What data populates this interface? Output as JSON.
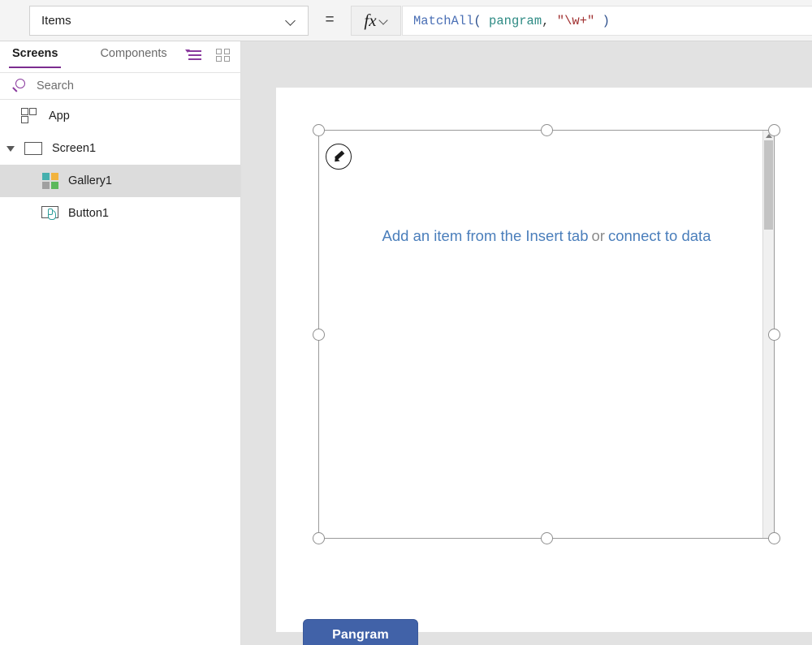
{
  "formula_bar": {
    "property_label": "Items",
    "property_icon": "chevron-down-icon",
    "equals": "=",
    "fx_label": "fx",
    "fx_icon": "fx-chevron-down-icon",
    "formula_tokens": [
      {
        "text": "MatchAll",
        "kind": "fn"
      },
      {
        "text": "(",
        "kind": "paren"
      },
      {
        "text": " ",
        "kind": "space"
      },
      {
        "text": "pangram",
        "kind": "ident"
      },
      {
        "text": ",",
        "kind": "punct"
      },
      {
        "text": " ",
        "kind": "space"
      },
      {
        "text": "\"\\w+\"",
        "kind": "string"
      },
      {
        "text": " ",
        "kind": "space"
      },
      {
        "text": ")",
        "kind": "paren"
      }
    ],
    "formula_plain": "MatchAll( pangram, \"\\w+\" )"
  },
  "left_panel": {
    "tabs": [
      {
        "label": "Screens",
        "active": true
      },
      {
        "label": "Components",
        "active": false
      }
    ],
    "tool_icons": [
      {
        "name": "tree-view-icon",
        "color": "#8a3a9e"
      },
      {
        "name": "thumbnail-grid-icon",
        "color": "#9a9a9a"
      }
    ],
    "search": {
      "placeholder": "Search",
      "value": "",
      "icon": "search-icon"
    },
    "tree": [
      {
        "label": "App",
        "icon": "app-layout-icon",
        "indent": 0,
        "selected": false,
        "twisty": "none"
      },
      {
        "label": "Screen1",
        "icon": "screen-icon",
        "indent": 0,
        "selected": false,
        "twisty": "open"
      },
      {
        "label": "Gallery1",
        "icon": "gallery-icon",
        "indent": 1,
        "selected": true,
        "twisty": "none"
      },
      {
        "label": "Button1",
        "icon": "button-icon",
        "indent": 1,
        "selected": false,
        "twisty": "none"
      }
    ]
  },
  "canvas": {
    "gallery": {
      "placeholder_link_1": "Add an item from the Insert tab",
      "placeholder_or": "or",
      "placeholder_link_2": "connect to data",
      "edit_badge_icon": "pencil-icon",
      "scrollbar_up_icon": "scroll-up-arrow-icon"
    },
    "button": {
      "label": "Pangram"
    }
  },
  "colors": {
    "accent_purple": "#8a3a9e",
    "link_blue": "#4a7ebb",
    "button_blue": "#4162a8",
    "canvas_gray": "#e2e2e2",
    "selection_gray": "#dcdcdc",
    "gallery_teal": "#46b0ae",
    "gallery_amber": "#f2b33d",
    "gallery_gray": "#a0a0a0",
    "gallery_green": "#5cb85c"
  }
}
